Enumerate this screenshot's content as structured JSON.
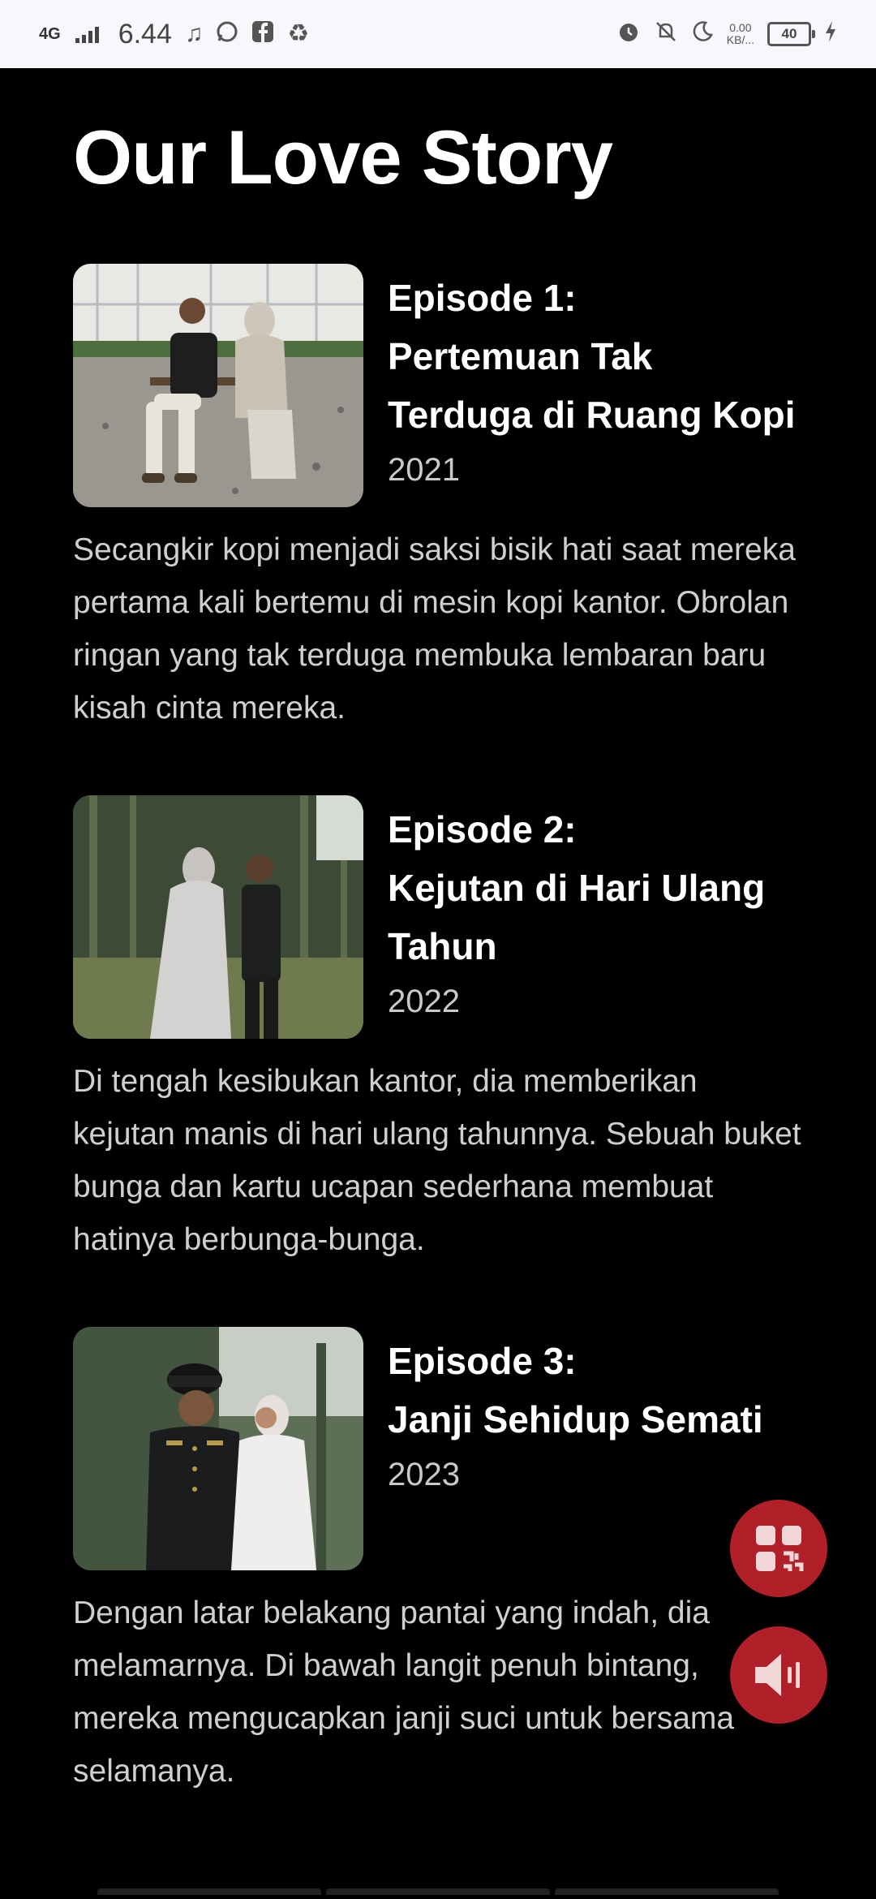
{
  "status_bar": {
    "network": "4G",
    "time": "6.44",
    "data_rate": "0.00",
    "data_unit": "KB/...",
    "battery": "40",
    "left_icons": [
      "music-icon",
      "whatsapp-icon",
      "facebook-icon",
      "recycle-icon"
    ],
    "right_icons": [
      "alarm-icon",
      "mute-icon",
      "moon-icon",
      "charging-icon"
    ]
  },
  "page": {
    "title": "Our Love Story"
  },
  "episodes": [
    {
      "label": "Episode 1:",
      "title": "Pertemuan Tak Terduga di Ruang Kopi",
      "year": "2021",
      "description": "Secangkir kopi menjadi saksi bisik hati saat mereka pertama kali bertemu di mesin kopi kantor. Obrolan ringan yang tak terduga membuka lembaran baru kisah cinta mereka."
    },
    {
      "label": "Episode 2:",
      "title": "Kejutan di Hari Ulang Tahun",
      "year": "2022",
      "description": "Di tengah kesibukan kantor, dia memberikan kejutan manis di hari ulang tahunnya. Sebuah buket bunga dan kartu ucapan sederhana membuat hatinya berbunga-bunga."
    },
    {
      "label": "Episode 3:",
      "title": "Janji Sehidup Semati",
      "year": "2023",
      "description": "Dengan latar belakang pantai yang indah, dia melamarnya. Di bawah langit penuh bintang, mereka mengucapkan janji suci untuk bersama selamanya."
    }
  ],
  "colors": {
    "background": "#000000",
    "accent": "#b11f29",
    "status_bar": "#f7f8fc"
  },
  "fab": [
    "qr-code-icon",
    "speaker-icon"
  ]
}
